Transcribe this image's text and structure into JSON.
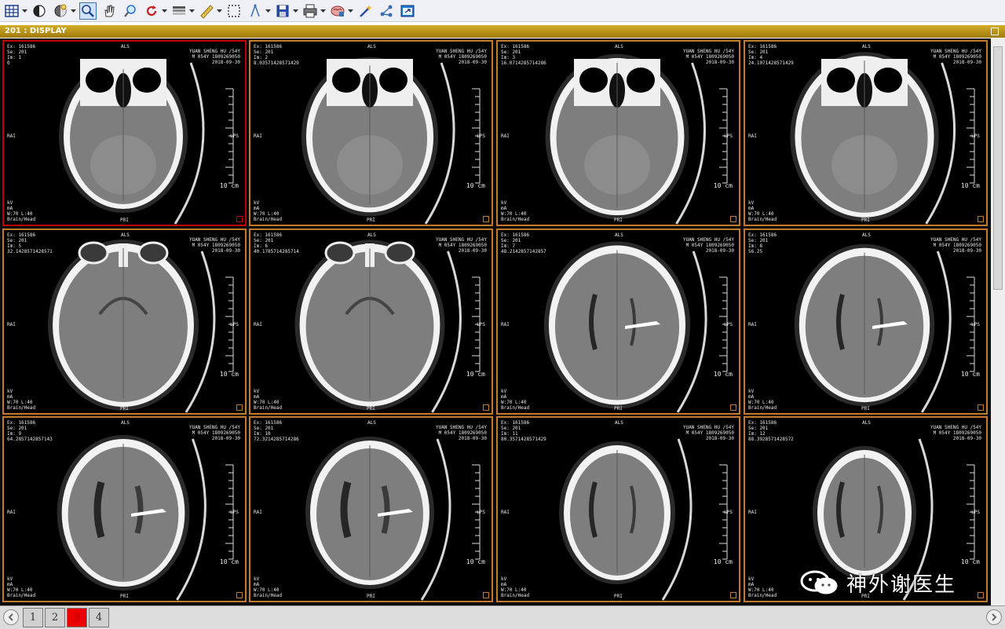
{
  "toolbar": {
    "tools": [
      {
        "icon": "layout-grid-icon",
        "dropdown": true
      },
      {
        "icon": "window-level-icon",
        "dropdown": false
      },
      {
        "icon": "preset-icon",
        "dropdown": true
      },
      {
        "icon": "zoom-icon",
        "dropdown": false,
        "active": true
      },
      {
        "icon": "pan-hand-icon",
        "dropdown": false
      },
      {
        "icon": "magnify-lens-icon",
        "dropdown": false
      },
      {
        "icon": "rotate-icon",
        "dropdown": true
      },
      {
        "icon": "color-map-icon",
        "dropdown": true
      },
      {
        "icon": "ruler-icon",
        "dropdown": true
      },
      {
        "icon": "roi-select-icon",
        "dropdown": false
      },
      {
        "icon": "angle-icon",
        "dropdown": true
      },
      {
        "icon": "save-icon",
        "dropdown": true
      },
      {
        "icon": "print-icon",
        "dropdown": true
      },
      {
        "icon": "brain-3d-icon",
        "dropdown": true
      },
      {
        "icon": "magic-wand-icon",
        "dropdown": false
      },
      {
        "icon": "link-icon",
        "dropdown": false
      },
      {
        "icon": "fit-window-icon",
        "dropdown": false
      }
    ]
  },
  "viewer_title": "201 : DISPLAY",
  "cells": [
    {
      "ex": "Ex: 161586",
      "se": "Se: 201",
      "im": "Im: 1",
      "pos": "0",
      "level": 1,
      "selected": true
    },
    {
      "ex": "Ex: 161586",
      "se": "Se: 201",
      "im": "Im: 2",
      "pos": "8.03571428571429",
      "level": 2
    },
    {
      "ex": "Ex: 161586",
      "se": "Se: 201",
      "im": "Im: 3",
      "pos": "16.0714285714286",
      "level": 3
    },
    {
      "ex": "Ex: 161586",
      "se": "Se: 201",
      "im": "Im: 4",
      "pos": "24.1071428571429",
      "level": 4
    },
    {
      "ex": "Ex: 161586",
      "se": "Se: 201",
      "im": "Im: 5",
      "pos": "32.1428571428571",
      "level": 5
    },
    {
      "ex": "Ex: 161586",
      "se": "Se: 201",
      "im": "Im: 6",
      "pos": "40.1785714285714",
      "level": 6
    },
    {
      "ex": "Ex: 161586",
      "se": "Se: 201",
      "im": "Im: 7",
      "pos": "48.2142857142857",
      "level": 7
    },
    {
      "ex": "Ex: 161586",
      "se": "Se: 201",
      "im": "Im: 8",
      "pos": "56.25",
      "level": 8
    },
    {
      "ex": "Ex: 161586",
      "se": "Se: 201",
      "im": "Im: 9",
      "pos": "64.2857142857143",
      "level": 9
    },
    {
      "ex": "Ex: 161586",
      "se": "Se: 201",
      "im": "Im: 10",
      "pos": "72.3214285714286",
      "level": 10
    },
    {
      "ex": "Ex: 161586",
      "se": "Se: 201",
      "im": "Im: 11",
      "pos": "80.3571428571429",
      "level": 11
    },
    {
      "ex": "Ex: 161586",
      "se": "Se: 201",
      "im": "Im: 12",
      "pos": "88.3928571428572",
      "level": 12
    }
  ],
  "patient": {
    "name": "YUAN SHENG HU /54Y",
    "id": "M 054Y 1809269050",
    "date": "2018-09-30"
  },
  "orientation": {
    "top": "ALS",
    "left": "RAI",
    "right": "LPS",
    "bottom": "PRI"
  },
  "acq": {
    "kv": "kV",
    "ma": "mA",
    "window": "W:70 L:40",
    "protocol": "Brain/Head"
  },
  "scale_label": "10 cm",
  "pages": [
    {
      "label": "1",
      "active": false
    },
    {
      "label": "2",
      "active": false
    },
    {
      "label": "3",
      "active": true
    },
    {
      "label": "4",
      "active": false
    }
  ],
  "watermark": "神外谢医生"
}
